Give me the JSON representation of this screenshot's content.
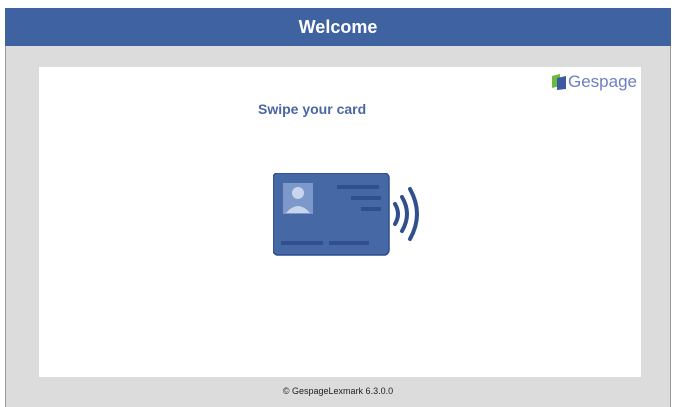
{
  "header": {
    "title": "Welcome"
  },
  "brand": {
    "logo_text": "Gespage"
  },
  "main": {
    "prompt": "Swipe your card"
  },
  "footer": {
    "copyright": "© GespageLexmark 6.3.0.0"
  },
  "colors": {
    "header_bg": "#3f62a0",
    "card_fill": "#4669a6",
    "card_dark": "#2f4f8e",
    "logo_text": "#6e7fc0",
    "logo_green": "#6dbb3b",
    "logo_blue": "#3b5aa0"
  },
  "icons": {
    "card": "id-card-contactless-icon",
    "logo": "gespage-logo-icon"
  }
}
